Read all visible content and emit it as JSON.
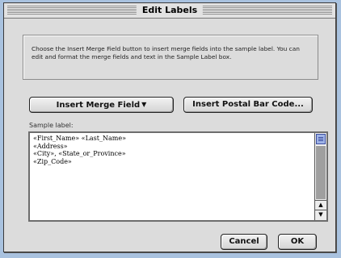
{
  "window": {
    "title": "Edit Labels"
  },
  "instructions": "Choose the Insert Merge Field button to insert merge fields into the sample label. You can edit and format the merge fields and text in the Sample Label box.",
  "buttons": {
    "insert_merge_field": "Insert Merge Field",
    "insert_postal_bar_code": "Insert Postal Bar Code...",
    "cancel": "Cancel",
    "ok": "OK"
  },
  "sample": {
    "label": "Sample label:",
    "lines": [
      "«First_Name» «Last_Name»",
      "«Address»",
      "«City», «State_or_Province»",
      "«Zip_Code»"
    ]
  },
  "icons": {
    "dropdown": "chevron-down-icon",
    "scroll_up": "up-arrow-icon",
    "scroll_down": "down-arrow-icon"
  },
  "colors": {
    "desktop": "#a9c2df",
    "dialog": "#dcdcdc",
    "scroll_thumb": "#9fb3e6"
  }
}
